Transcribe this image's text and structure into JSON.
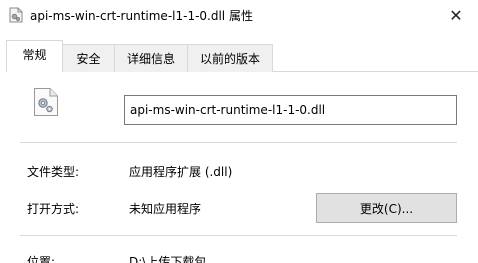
{
  "window": {
    "title": "api-ms-win-crt-runtime-l1-1-0.dll 属性",
    "close_glyph": "✕"
  },
  "tabs": [
    {
      "label": "常规",
      "active": true
    },
    {
      "label": "安全",
      "active": false
    },
    {
      "label": "详细信息",
      "active": false
    },
    {
      "label": "以前的版本",
      "active": false
    }
  ],
  "general": {
    "file_name": "api-ms-win-crt-runtime-l1-1-0.dll",
    "file_type_label": "文件类型:",
    "file_type_value": "应用程序扩展 (.dll)",
    "open_with_label": "打开方式:",
    "open_with_value": "未知应用程序",
    "change_button": "更改(C)...",
    "location_label": "位置:",
    "location_value": "D:\\上传下载包"
  },
  "icons": {
    "title": "dll-file-icon",
    "file": "dll-file-icon",
    "close": "close-icon"
  }
}
